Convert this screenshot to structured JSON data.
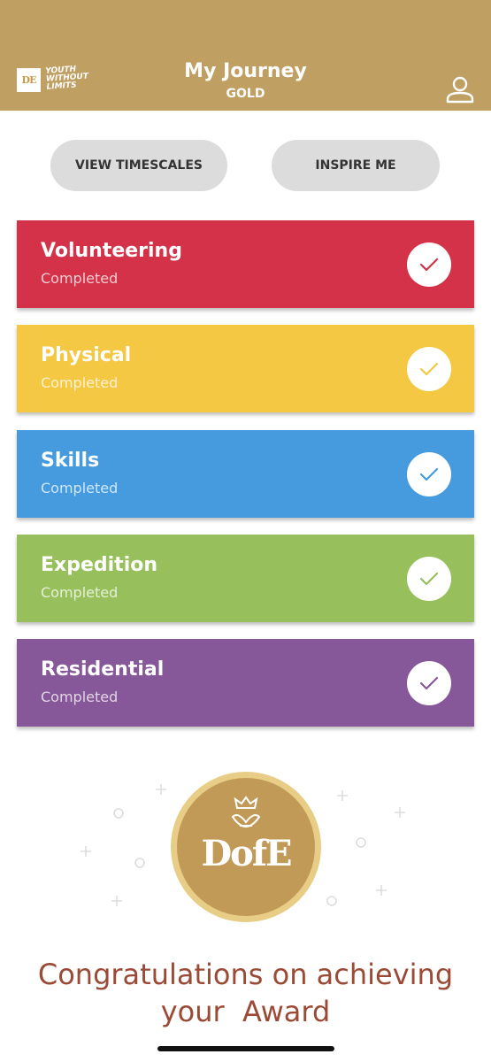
{
  "header": {
    "logo_mark": "DE",
    "logo_text_line1": "YOUTH",
    "logo_text_line2": "WITHOUT",
    "logo_text_line3": "LIMITS",
    "title": "My Journey",
    "level": "GOLD",
    "profile_icon": "person-icon",
    "background_color": "#bf9f62"
  },
  "actions": {
    "timescales_label": "VIEW TIMESCALES",
    "inspire_label": "INSPIRE ME"
  },
  "sections": [
    {
      "name": "Volunteering",
      "status": "Completed",
      "color": "#d33249"
    },
    {
      "name": "Physical",
      "status": "Completed",
      "color": "#f4c842"
    },
    {
      "name": "Skills",
      "status": "Completed",
      "color": "#459bdd"
    },
    {
      "name": "Expedition",
      "status": "Completed",
      "color": "#97c05d"
    },
    {
      "name": "Residential",
      "status": "Completed",
      "color": "#865799"
    }
  ],
  "award": {
    "badge_text": "DofE",
    "message_line1": "Congratulations on achieving",
    "message_line2": "your  Award"
  }
}
